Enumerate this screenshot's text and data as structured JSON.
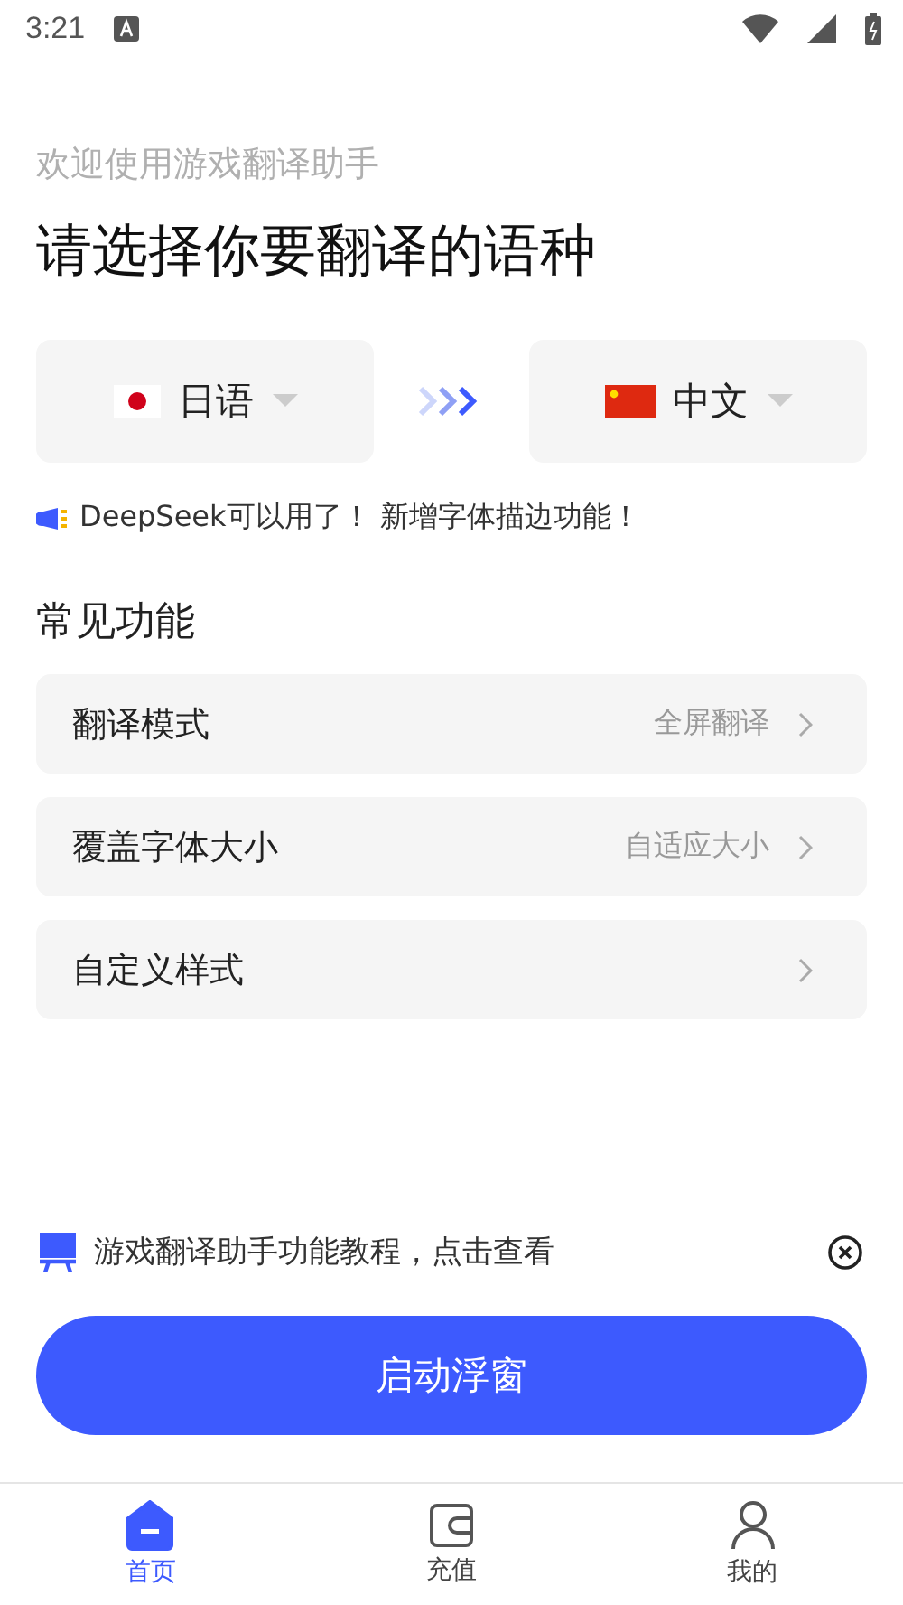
{
  "status_bar": {
    "time": "3:21"
  },
  "header": {
    "subtitle": "欢迎使用游戏翻译助手",
    "title": "请选择你要翻译的语种"
  },
  "languages": [
    {
      "label": "日语",
      "kind": "japan"
    },
    {
      "label": "中文",
      "kind": "china"
    }
  ],
  "notice": "DeepSeek可以用了！ 新增字体描边功能！",
  "section_title": "常见功能",
  "settings": [
    {
      "label": "翻译模式",
      "value": "全屏翻译"
    },
    {
      "label": "覆盖字体大小",
      "value": "自适应大小"
    },
    {
      "label": "自定义样式"
    }
  ],
  "tutorial_banner": "游戏翻译助手功能教程，点击查看",
  "start_button": "启动浮窗",
  "nav": [
    {
      "label": "首页",
      "kind": "home",
      "selected": true
    },
    {
      "label": "充值",
      "kind": "wallet",
      "selected": false
    },
    {
      "label": "我的",
      "kind": "user",
      "selected": false
    }
  ]
}
